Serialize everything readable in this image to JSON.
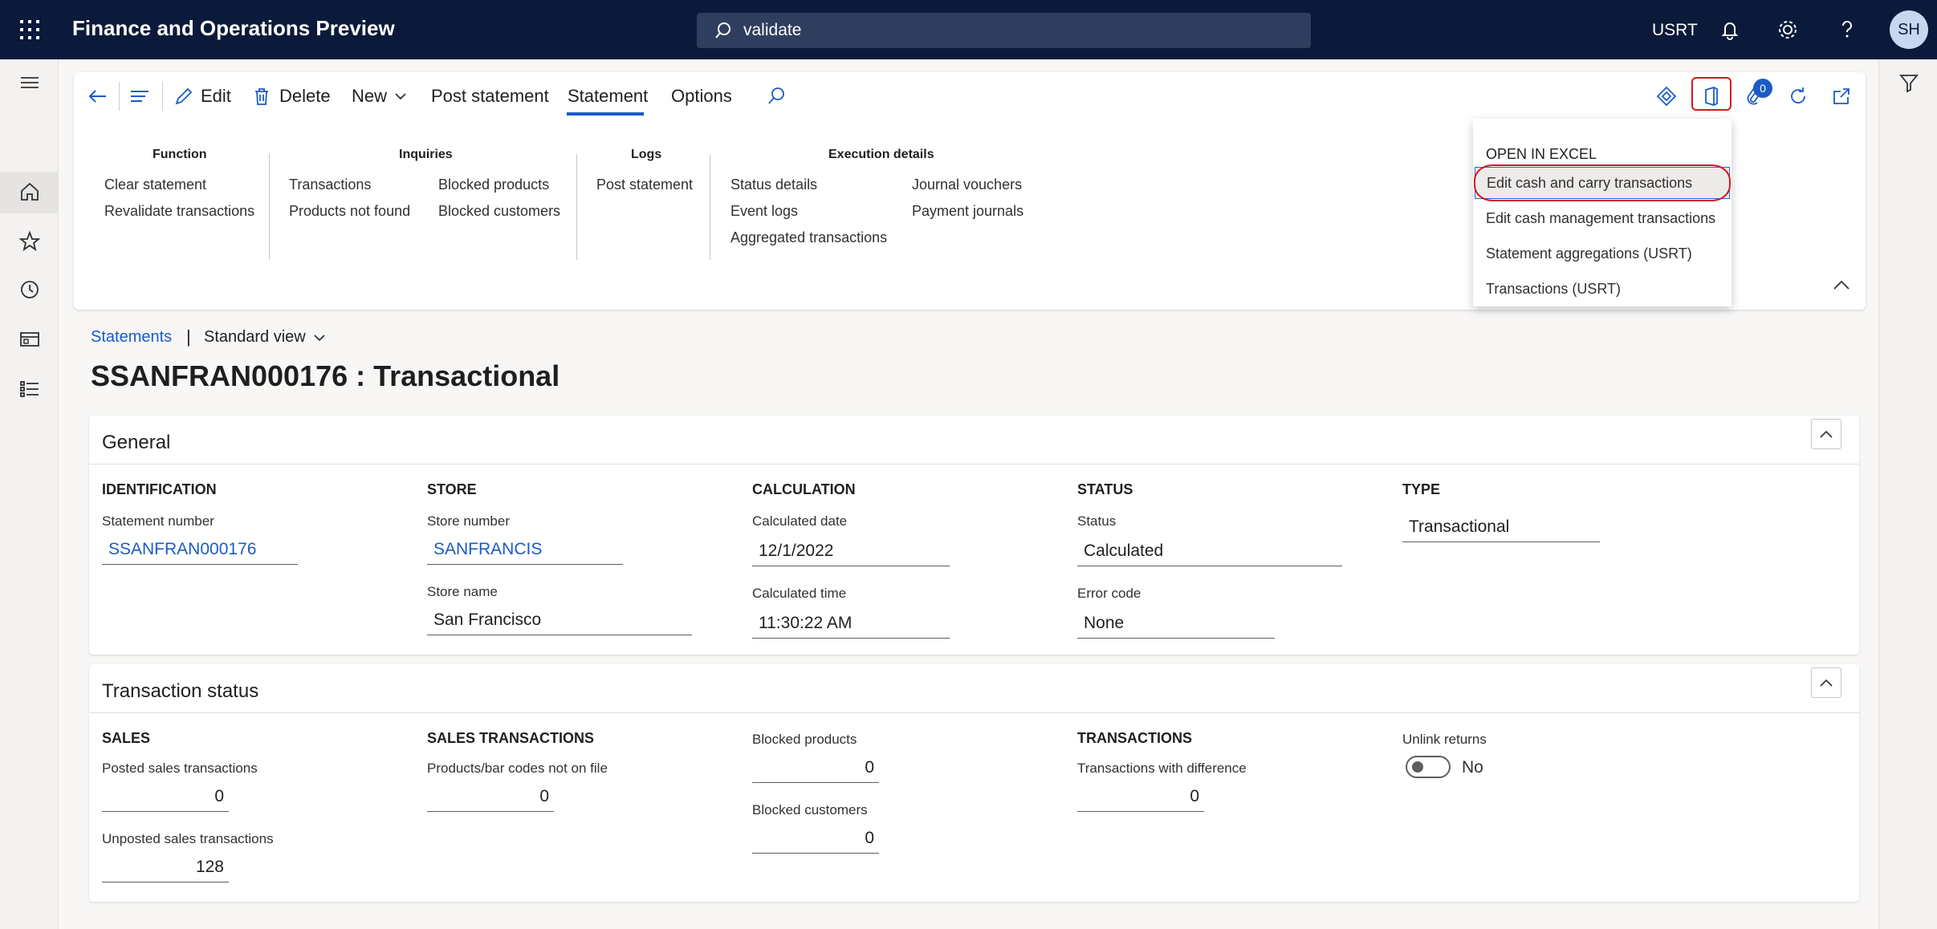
{
  "topbar": {
    "app_title": "Finance and Operations Preview",
    "search_value": "validate",
    "company": "USRT",
    "avatar_initials": "SH",
    "bg_color": "#0b1a3a"
  },
  "actions": {
    "edit": "Edit",
    "delete": "Delete",
    "new": "New",
    "post_statement": "Post statement",
    "tab_statement": "Statement",
    "tab_options": "Options",
    "attachments_count": "0"
  },
  "ribbon": {
    "function": {
      "title": "Function",
      "items": [
        "Clear statement",
        "Revalidate transactions"
      ]
    },
    "inquiries": {
      "title": "Inquiries",
      "items": [
        "Transactions",
        "Products not found",
        "Blocked products",
        "Blocked customers"
      ]
    },
    "logs": {
      "title": "Logs",
      "items": [
        "Post statement"
      ]
    },
    "execution": {
      "title": "Execution details",
      "items": [
        "Status details",
        "Event logs",
        "Aggregated transactions",
        "Journal vouchers",
        "Payment journals"
      ]
    }
  },
  "excel_menu": {
    "header": "OPEN IN EXCEL",
    "items": [
      "Edit cash and carry transactions",
      "Edit cash management transactions",
      "Statement aggregations (USRT)",
      "Transactions (USRT)"
    ]
  },
  "breadcrumb": {
    "link": "Statements",
    "separator": "|",
    "view": "Standard view"
  },
  "page_title": "SSANFRAN000176 : Transactional",
  "general": {
    "title": "General",
    "identification": {
      "head": "IDENTIFICATION",
      "statement_number_label": "Statement number",
      "statement_number": "SSANFRAN000176"
    },
    "store": {
      "head": "STORE",
      "store_number_label": "Store number",
      "store_number": "SANFRANCIS",
      "store_name_label": "Store name",
      "store_name": "San Francisco"
    },
    "calculation": {
      "head": "CALCULATION",
      "date_label": "Calculated date",
      "date": "12/1/2022",
      "time_label": "Calculated time",
      "time": "11:30:22 AM"
    },
    "status": {
      "head": "STATUS",
      "status_label": "Status",
      "status": "Calculated",
      "error_label": "Error code",
      "error": "None"
    },
    "type": {
      "head": "TYPE",
      "value": "Transactional"
    }
  },
  "transaction_status": {
    "title": "Transaction status",
    "sales": {
      "head": "SALES",
      "posted_label": "Posted sales transactions",
      "posted": "0",
      "unposted_label": "Unposted sales transactions",
      "unposted": "128"
    },
    "sales_transactions": {
      "head": "SALES TRANSACTIONS",
      "not_on_file_label": "Products/bar codes not on file",
      "not_on_file": "0"
    },
    "blocked": {
      "products_label": "Blocked products",
      "products": "0",
      "customers_label": "Blocked customers",
      "customers": "0"
    },
    "transactions": {
      "head": "TRANSACTIONS",
      "diff_label": "Transactions with difference",
      "diff": "0"
    },
    "unlink": {
      "label": "Unlink returns",
      "value": "No"
    }
  },
  "colors": {
    "accent": "#1b5bc6",
    "highlight": "#d9151e"
  }
}
